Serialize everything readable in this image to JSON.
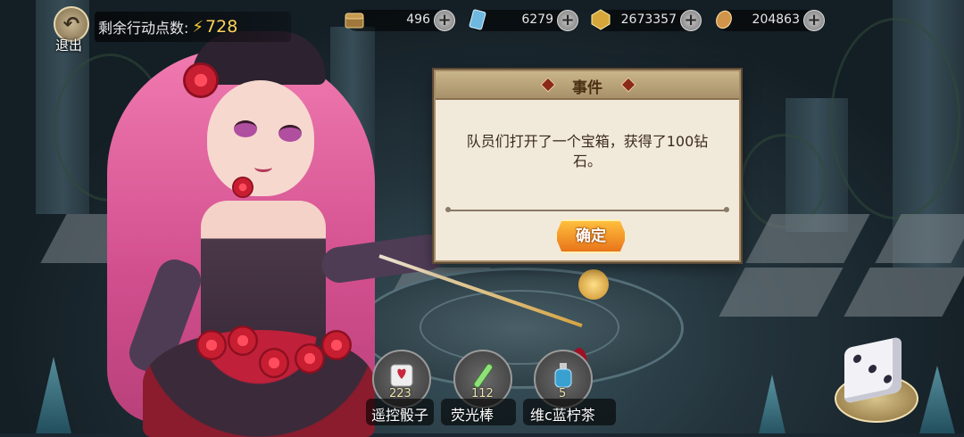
{
  "hud": {
    "back_label": "退出",
    "action_points_label": "剩余行动点数:",
    "action_points_value": "728"
  },
  "resources": [
    {
      "icon": "chest-icon",
      "value": "496"
    },
    {
      "icon": "crystal-card-icon",
      "value": "6279"
    },
    {
      "icon": "gold-coin-icon",
      "value": "2673357"
    },
    {
      "icon": "amber-gem-icon",
      "value": "204863"
    }
  ],
  "dialog": {
    "title": "事件",
    "message": "队员们打开了一个宝箱，获得了100钻石。",
    "confirm_label": "确定"
  },
  "items": [
    {
      "icon": "dice-item-icon",
      "count": "223",
      "name": "遥控骰子"
    },
    {
      "icon": "glowstick-icon",
      "count": "112",
      "name": "荧光棒"
    },
    {
      "icon": "potion-bottle-icon",
      "count": "5",
      "name": "维c蓝柠茶"
    }
  ],
  "colors": {
    "accent_gold": "#ffd35a",
    "button_orange": "#e8741a",
    "dialog_bg": "#f1e9da"
  }
}
